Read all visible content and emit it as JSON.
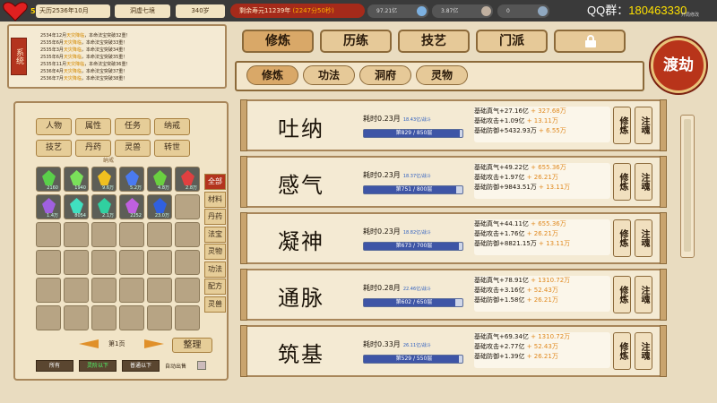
{
  "topbar": {
    "hp_badge": "54",
    "date": "天历2536年10月",
    "realm": "洞虚七境",
    "age": "340岁",
    "remain_life": "剩余寿元11239年",
    "remain_time": "(2247分50秒)",
    "resource_1": "97.21亿",
    "resource_2": "3.87亿",
    "resource_3": "0",
    "qq_label": "QQ群：",
    "qq_number": "180463330",
    "corner_label": "开局修改"
  },
  "log": {
    "tag": "系统",
    "lines": [
      {
        "date": "2534年12月",
        "hl": "天灾降临",
        "rest": "，本命法宝突破32重！"
      },
      {
        "date": "2535年6月",
        "hl": "天灾降临",
        "rest": "，本命法宝突破33重！"
      },
      {
        "date": "2535年3月",
        "hl": "天灾降临",
        "rest": "，本命法宝突破34重！"
      },
      {
        "date": "2535年6月",
        "hl": "天灾降临",
        "rest": "，本命法宝突破35重！"
      },
      {
        "date": "2535年11月",
        "hl": "天灾降临",
        "rest": "，本命法宝突破36重！"
      },
      {
        "date": "2536年4月",
        "hl": "天灾降临",
        "rest": "，本命法宝突破37重！"
      },
      {
        "date": "2536年7月",
        "hl": "天灾降临",
        "rest": "，本命法宝突破38重！"
      }
    ]
  },
  "left": {
    "cat_buttons": [
      "人物",
      "属性",
      "任务",
      "纳戒",
      "技艺",
      "丹药",
      "灵兽",
      "转世"
    ],
    "bag_label": "纳戒",
    "items": [
      {
        "count": "2160",
        "color": "#5ad04a"
      },
      {
        "count": "1940",
        "color": "#7ae05a"
      },
      {
        "count": "9.6万",
        "color": "#f0c020"
      },
      {
        "count": "5.2万",
        "color": "#4a7af0"
      },
      {
        "count": "4.8万",
        "color": "#6ad040"
      },
      {
        "count": "2.8万",
        "color": "#e04040"
      },
      {
        "count": "1.4万",
        "color": "#a060e0"
      },
      {
        "count": "8054",
        "color": "#40e0c0"
      },
      {
        "count": "2.1万",
        "color": "#30d0a0"
      },
      {
        "count": "2252",
        "color": "#c060e0"
      },
      {
        "count": "23.0万",
        "color": "#3060e0"
      }
    ],
    "side_tabs": [
      "全部",
      "材料",
      "丹药",
      "法宝",
      "灵物",
      "功法",
      "配方",
      "灵兽"
    ],
    "page_text": "第1页",
    "sort": "整理",
    "bottom_buttons": [
      "所有",
      "灵阶以下",
      "普通以下"
    ],
    "auto_label": "自动出售"
  },
  "main_tabs": [
    "修炼",
    "历练",
    "技艺",
    "门派"
  ],
  "sub_tabs": [
    "修炼",
    "功法",
    "洞府",
    "灵物"
  ],
  "dujie": "渡劫",
  "rows": [
    {
      "name": "吐纳",
      "time": "耗时0.23月",
      "time_small": "18.43亿/战斗",
      "progress": "第829 / 850层",
      "fill": 0.975,
      "stats": [
        {
          "base": "基础真气+27.16亿",
          "plus": "+ 327.68万"
        },
        {
          "base": "基础攻击+1.09亿",
          "plus": "+ 13.11万"
        },
        {
          "base": "基础防御+5432.93万",
          "plus": "+ 6.55万"
        }
      ]
    },
    {
      "name": "感气",
      "time": "耗时0.23月",
      "time_small": "18.37亿/战斗",
      "progress": "第751 / 800层",
      "fill": 0.939,
      "stats": [
        {
          "base": "基础真气+49.22亿",
          "plus": "+ 655.36万"
        },
        {
          "base": "基础攻击+1.97亿",
          "plus": "+ 26.21万"
        },
        {
          "base": "基础防御+9843.51万",
          "plus": "+ 13.11万"
        }
      ]
    },
    {
      "name": "凝神",
      "time": "耗时0.23月",
      "time_small": "18.82亿/战斗",
      "progress": "第673 / 700层",
      "fill": 0.961,
      "stats": [
        {
          "base": "基础真气+44.11亿",
          "plus": "+ 655.36万"
        },
        {
          "base": "基础攻击+1.76亿",
          "plus": "+ 26.21万"
        },
        {
          "base": "基础防御+8821.15万",
          "plus": "+ 13.11万"
        }
      ]
    },
    {
      "name": "通脉",
      "time": "耗时0.28月",
      "time_small": "22.46亿/战斗",
      "progress": "第602 / 650层",
      "fill": 0.926,
      "stats": [
        {
          "base": "基础真气+78.91亿",
          "plus": "+ 1310.72万"
        },
        {
          "base": "基础攻击+3.16亿",
          "plus": "+ 52.43万"
        },
        {
          "base": "基础防御+1.58亿",
          "plus": "+ 26.21万"
        }
      ]
    },
    {
      "name": "筑基",
      "time": "耗时0.33月",
      "time_small": "26.11亿/战斗",
      "progress": "第529 / 550层",
      "fill": 0.962,
      "stats": [
        {
          "base": "基础真气+69.34亿",
          "plus": "+ 1310.72万"
        },
        {
          "base": "基础攻击+2.77亿",
          "plus": "+ 52.43万"
        },
        {
          "base": "基础防御+1.39亿",
          "plus": "+ 26.21万"
        }
      ]
    }
  ],
  "row_buttons": [
    "修炼",
    "注魂"
  ]
}
